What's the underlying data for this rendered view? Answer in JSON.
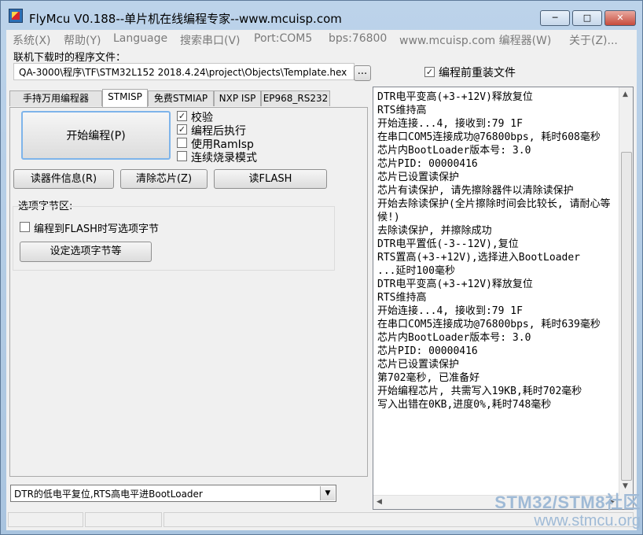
{
  "window": {
    "title": "FlyMcu V0.188--单片机在线编程专家--www.mcuisp.com",
    "minimize_icon": "minimize-icon",
    "maximize_icon": "maximize-icon",
    "close_icon": "close-icon"
  },
  "menu": {
    "items": [
      "系统(X)",
      "帮助(Y)",
      "Language",
      "搜索串口(V)",
      "Port:COM5",
      "bps:76800",
      "www.mcuisp.com 编程器(W)",
      "关于(Z)..."
    ]
  },
  "file": {
    "label": "联机下载时的程序文件：",
    "path": "QA-3000\\程序\\TF\\STM32L152  2018.4.24\\project\\Objects\\Template.hex",
    "browse_label": "...",
    "reload_label": "编程前重装文件",
    "reload_checked": true
  },
  "tabs": {
    "items": [
      "手持万用编程器",
      "STMISP",
      "免费STMIAP",
      "NXP ISP",
      "EP968_RS232"
    ],
    "active_index": 1
  },
  "stmisp": {
    "start_label": "开始编程(P)",
    "options": [
      {
        "label": "校验",
        "checked": true
      },
      {
        "label": "编程后执行",
        "checked": true
      },
      {
        "label": "使用RamIsp",
        "checked": false
      },
      {
        "label": "连续烧录模式",
        "checked": false
      }
    ],
    "read_info_label": "读器件信息(R)",
    "erase_label": "清除芯片(Z)",
    "read_flash_label": "读FLASH",
    "option_group_label": "选项字节区:",
    "write_option_label": "编程到FLASH时写选项字节",
    "write_option_checked": false,
    "set_option_label": "设定选项字节等"
  },
  "log": {
    "text": "DTR电平变高(+3-+12V)释放复位\nRTS维持高\n开始连接...4, 接收到:79 1F\n在串口COM5连接成功@76800bps, 耗时608毫秒\n芯片内BootLoader版本号: 3.0\n芯片PID: 00000416\n芯片已设置读保护\n芯片有读保护, 请先擦除器件以清除读保护\n开始去除读保护(全片擦除时间会比较长, 请耐心等候!)\n去除读保护, 并擦除成功\nDTR电平置低(-3--12V),复位\nRTS置高(+3-+12V),选择进入BootLoader\n...延时100毫秒\nDTR电平变高(+3-+12V)释放复位\nRTS维持高\n开始连接...4, 接收到:79 1F\n在串口COM5连接成功@76800bps, 耗时639毫秒\n芯片内BootLoader版本号: 3.0\n芯片PID: 00000416\n芯片已设置读保护\n第702毫秒, 已准备好\n开始编程芯片, 共需写入19KB,耗时702毫秒\n写入出错在0KB,进度0%,耗时748毫秒"
  },
  "reset_mode": {
    "selected": "DTR的低电平复位,RTS高电平进BootLoader"
  },
  "watermark": {
    "line1": "STM32/STM8社区",
    "line2": "www.stmcu.org"
  },
  "colors": {
    "titlebar": "#bcd3ea",
    "client": "#f0f0f0",
    "watermark": "#9fbad6"
  }
}
